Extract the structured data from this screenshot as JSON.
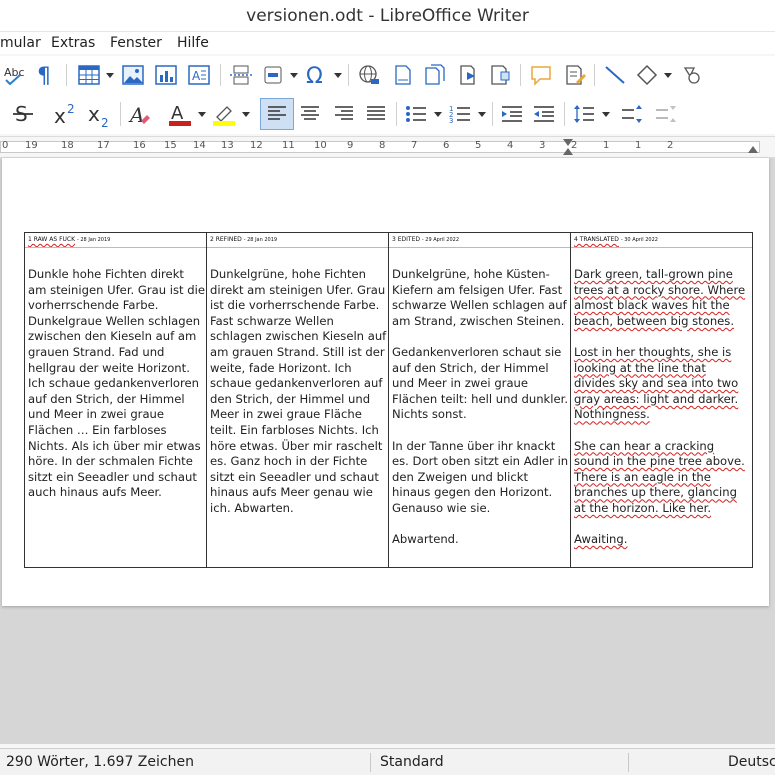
{
  "window": {
    "title": "versionen.odt - LibreOffice Writer"
  },
  "menu": {
    "items": [
      "mular",
      "Extras",
      "Fenster",
      "Hilfe"
    ]
  },
  "ruler": {
    "numbers": [
      "0",
      "19",
      "18",
      "17",
      "16",
      "15",
      "14",
      "13",
      "12",
      "11",
      "10",
      "9",
      "8",
      "7",
      "6",
      "5",
      "4",
      "3",
      "2",
      "1",
      "1",
      "2"
    ]
  },
  "document": {
    "columns": [
      {
        "heading": "1 RAW AS FUCK",
        "date": "- 28 Jan 2019",
        "paragraphs": [
          "Dunkle hohe Fichten direkt am steinigen Ufer. Grau ist die vorherrschende Farbe. Dunkelgraue Wellen schlagen zwischen den Kieseln auf am grauen Strand. Fad und hellgrau der weite Horizont. Ich schaue gedankenverloren auf den Strich, der Himmel und Meer in zwei graue Flächen … Ein farbloses Nichts. Als ich über mir etwas höre. In der schmalen Fichte sitzt ein Seeadler und schaut auch hinaus aufs Meer."
        ]
      },
      {
        "heading": "2 REFINED",
        "date": "- 28 Jan 2019",
        "paragraphs": [
          "Dunkelgrüne, hohe Fichten direkt am steinigen Ufer. Grau ist die vorherrschende Farbe. Fast schwarze Wellen schlagen zwischen Kieseln auf am grauen Strand. Still ist der weite, fade Horizont. Ich schaue gedankenverloren auf den Strich, der Himmel und Meer in zwei graue Fläche teilt. Ein farbloses Nichts. Ich höre etwas. Über mir raschelt es. Ganz hoch in der Fichte sitzt ein Seeadler und schaut hinaus aufs Meer genau wie ich. Abwarten."
        ]
      },
      {
        "heading": "3 EDITED",
        "date": "- 29 April 2022",
        "paragraphs": [
          "Dunkelgrüne, hohe Küsten-Kiefern am felsigen Ufer. Fast schwarze Wellen schlagen auf am Strand, zwischen Steinen.",
          "Gedankenverloren schaut sie auf den Strich, der Himmel und Meer in zwei graue Flächen teilt: hell und dunkler. Nichts sonst.",
          "In der Tanne über ihr knackt es. Dort oben sitzt ein Adler in den Zweigen und blickt hinaus gegen den Horizont. Genauso wie sie.",
          "Abwartend."
        ]
      },
      {
        "heading": "4 TRANSLATED",
        "date": "- 30 April 2022",
        "paragraphs": [
          "Dark green, tall-grown pine trees at a rocky shore. Where almost black waves hit the beach, between big stones.",
          "Lost in her thoughts, she is looking at the line that divides sky and sea into two gray areas: light and darker. Nothingness.",
          "She can hear a cracking sound in the pine tree above. There is an eagle in the branches up there, glancing at the horizon. Like her.",
          "Awaiting."
        ]
      }
    ]
  },
  "statusbar": {
    "word_count": "290 Wörter, 1.697 Zeichen",
    "page_style": "Standard",
    "language": "Deutsc"
  }
}
